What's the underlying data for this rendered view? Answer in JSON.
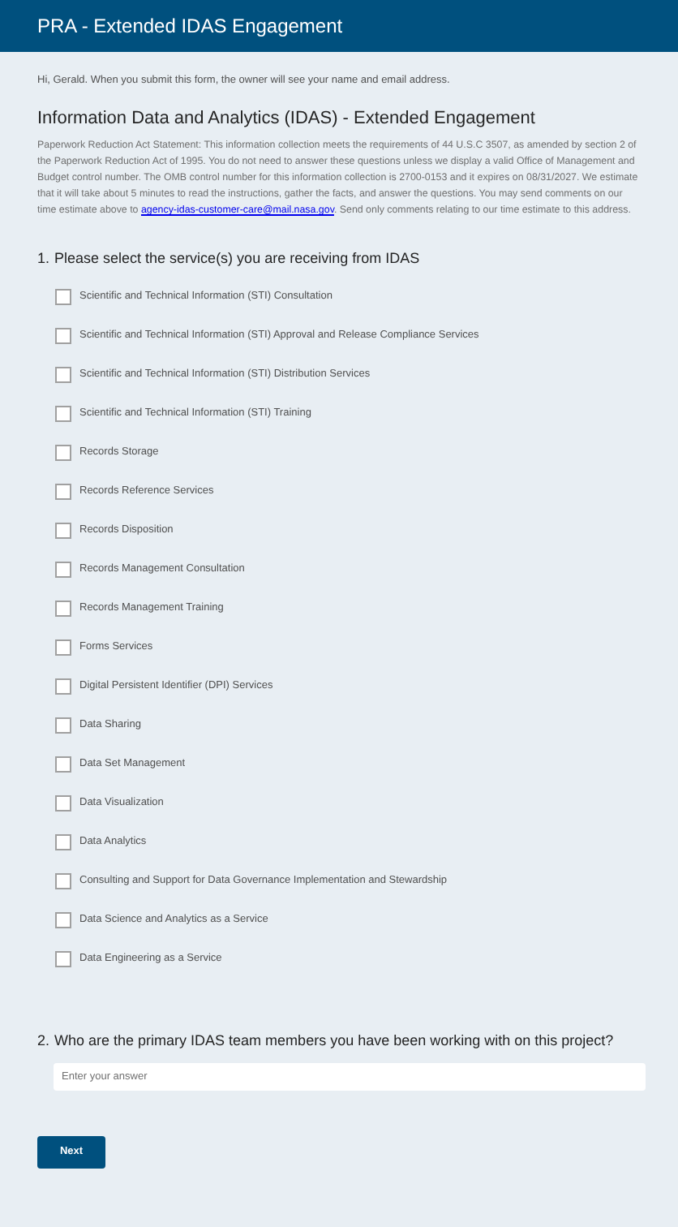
{
  "header": {
    "title": "PRA - Extended IDAS Engagement"
  },
  "greeting": "Hi, Gerald. When you submit this form, the owner will see your name and email address.",
  "form_title": "Information Data and Analytics (IDAS) - Extended Engagement",
  "statement": {
    "text_before": "Paperwork Reduction Act Statement: This information collection meets the requirements of 44 U.S.C 3507, as amended by section 2 of the Paperwork Reduction Act of 1995. You do not need to answer these questions unless we display a valid Office of Management and Budget control number. The OMB control number for this information collection is 2700-0153 and it expires on 08/31/2027. We estimate that it will take about 5 minutes to read the instructions, gather the facts, and answer the questions. You may send comments on our time estimate above to",
    "link": "agency-idas-customer-care@mail.nasa.gov",
    "text_after": ". Send only comments relating to our time estimate to this address."
  },
  "questions": [
    {
      "kind": "checkboxes",
      "number": "1.",
      "text": "Please select the service(s) you are receiving from IDAS",
      "options": [
        {
          "label": "Scientific and Technical Information (STI) Consultation",
          "checked": false
        },
        {
          "label": "Scientific and Technical Information (STI) Approval and Release Compliance Services",
          "checked": false
        },
        {
          "label": "Scientific and Technical Information (STI) Distribution Services",
          "checked": false
        },
        {
          "label": "Scientific and Technical Information (STI) Training",
          "checked": false
        },
        {
          "label": "Records Storage",
          "checked": false
        },
        {
          "label": "Records Reference Services",
          "checked": false
        },
        {
          "label": "Records Disposition",
          "checked": false
        },
        {
          "label": "Records Management Consultation",
          "checked": false
        },
        {
          "label": "Records Management Training",
          "checked": false
        },
        {
          "label": "Forms Services",
          "checked": false
        },
        {
          "label": "Digital Persistent Identifier (DPI) Services",
          "checked": false
        },
        {
          "label": "Data Sharing",
          "checked": false
        },
        {
          "label": "Data Set Management",
          "checked": false
        },
        {
          "label": "Data Visualization",
          "checked": false
        },
        {
          "label": "Data Analytics",
          "checked": false
        },
        {
          "label": "Consulting and Support for Data Governance Implementation and Stewardship",
          "checked": false
        },
        {
          "label": "Data Science and Analytics as a Service",
          "checked": false
        },
        {
          "label": "Data Engineering as a Service",
          "checked": false
        }
      ]
    },
    {
      "kind": "text",
      "number": "2.",
      "text": "Who are the primary IDAS team members you have been working with on this project?",
      "placeholder": "Enter your answer"
    }
  ],
  "next_button": "Next"
}
